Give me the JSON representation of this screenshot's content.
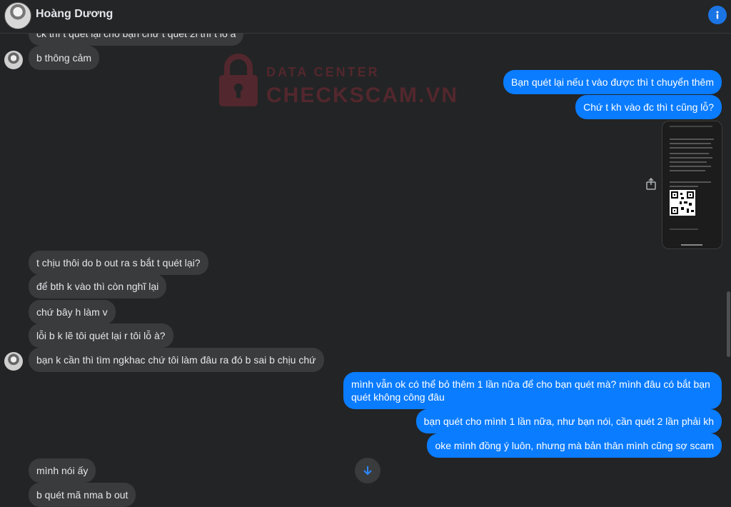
{
  "header": {
    "contact_name": "Hoàng Dương",
    "info_icon": "info-icon"
  },
  "watermark": {
    "line1": "DATA CENTER",
    "line2": "CHECKSCAM.VN"
  },
  "messages": {
    "in_cut_top": "ck thì t quét lại cho bạn chứ t quét 2l thì t lỗ à",
    "in_1": "b thông cảm",
    "out_1": "Bạn quét lại nếu t vào được thì t chuyển thêm",
    "out_2": "Chứ t kh vào đc thì t cũng lỗ?",
    "in_2": "t chịu thôi do b out ra s bắt t quét lại?",
    "in_3": "để bth k vào thì còn nghĩ lại",
    "in_4": "chứ bây h làm v",
    "in_5": "lỗi b k lẽ tôi quét lại r tôi lỗ à?",
    "in_6": "bạn k cần thì tìm ngkhac chứ tôi làm đâu ra đó b sai b chịu chứ",
    "out_3": "mình vẫn ok có thể bỏ thêm 1 lần nữa để cho bạn quét mà? mình đâu có bắt bạn quét không công đâu",
    "out_4": "bạn quét cho mình 1 lần nữa, như bạn nói, cần quét 2 lần phải kh",
    "out_5": "oke mình đồng ý luôn, nhưng mà bản thân mình cũng sợ scam",
    "in_7": "mình nói ấy",
    "in_8": "b quét mã nma b out"
  },
  "colors": {
    "outgoing": "#0a7cff",
    "incoming": "#3a3b3c",
    "background": "#232425"
  }
}
